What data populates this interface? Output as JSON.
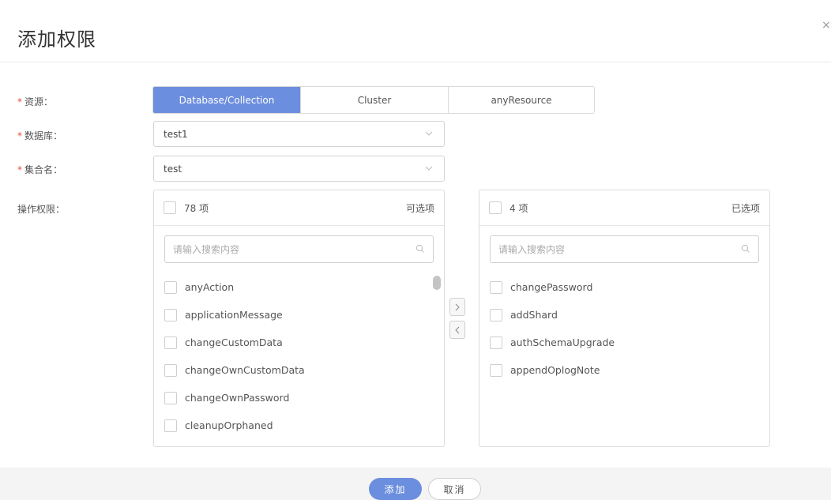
{
  "dialog": {
    "title": "添加权限",
    "close_label": "×"
  },
  "form": {
    "resource": {
      "label": "资源：",
      "required_mark": "*",
      "options": [
        "Database/Collection",
        "Cluster",
        "anyResource"
      ],
      "selected": "Database/Collection"
    },
    "database": {
      "label": "数据库：",
      "required_mark": "*",
      "value": "test1"
    },
    "collection": {
      "label": "集合名：",
      "required_mark": "*",
      "value": "test"
    },
    "permissions": {
      "label": "操作权限："
    }
  },
  "left_panel": {
    "count": "78 项",
    "title": "可选项",
    "search_placeholder": "请输入搜索内容",
    "items": [
      "anyAction",
      "applicationMessage",
      "changeCustomData",
      "changeOwnCustomData",
      "changeOwnPassword",
      "cleanupOrphaned"
    ]
  },
  "right_panel": {
    "count": "4 项",
    "title": "已选项",
    "search_placeholder": "请输入搜索内容",
    "items": [
      "changePassword",
      "addShard",
      "authSchemaUpgrade",
      "appendOplogNote"
    ]
  },
  "transfer": {
    "to_right": ">",
    "to_left": "<"
  },
  "footer": {
    "confirm_label": "添加",
    "cancel_label": "取消"
  },
  "colors": {
    "accent": "#6c8ede",
    "required": "#e74c3c"
  }
}
